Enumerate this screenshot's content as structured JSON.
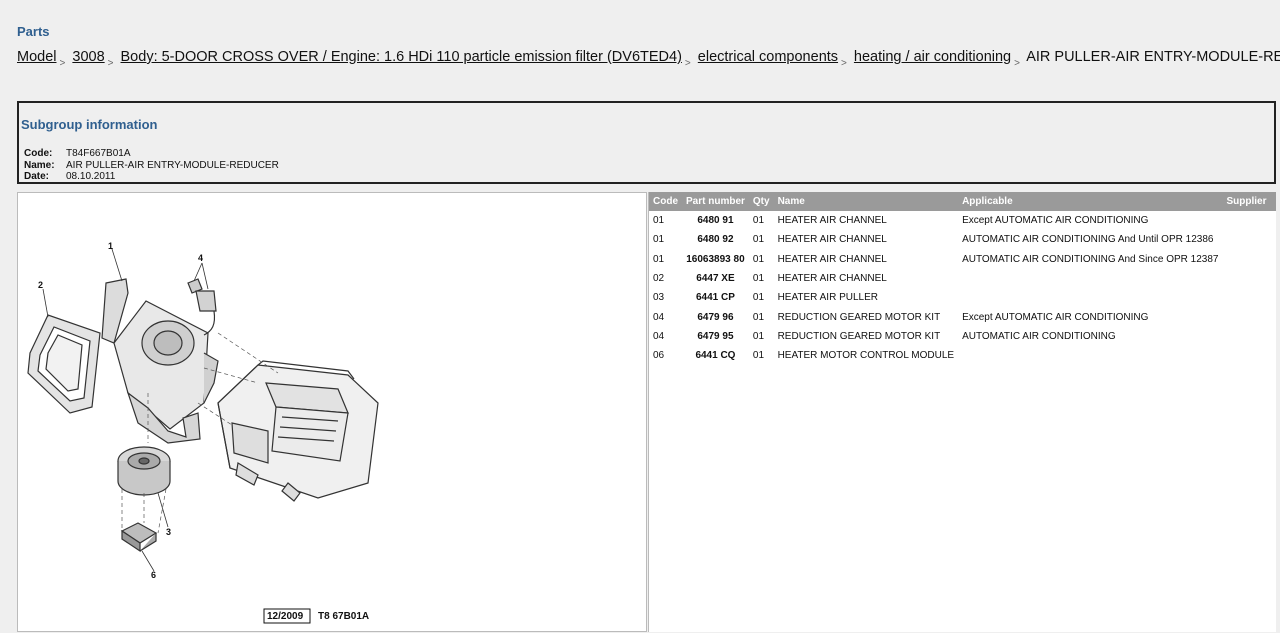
{
  "header": {
    "title": "Parts"
  },
  "breadcrumb": {
    "items": [
      "Model",
      "3008",
      "Body: 5-DOOR CROSS OVER / Engine: 1.6 HDi 110 particle emission filter (DV6TED4)",
      "electrical components",
      "heating / air conditioning"
    ],
    "current": "AIR PULLER-AIR ENTRY-MODULE-REDUCER",
    "separator": ">"
  },
  "subgroup": {
    "title": "Subgroup information",
    "code_label": "Code:",
    "code": "T84F667B01A",
    "name_label": "Name:",
    "name": "AIR PULLER-AIR ENTRY-MODULE-REDUCER",
    "date_label": "Date:",
    "date": "08.10.2011"
  },
  "diagram": {
    "callouts": [
      "1",
      "2",
      "3",
      "4",
      "6"
    ],
    "stamp_date": "12/2009",
    "stamp_ref": "T8 67B01A"
  },
  "table": {
    "headers": [
      "Code",
      "Part number",
      "Qty",
      "Name",
      "Applicable",
      "Supplier"
    ],
    "rows": [
      [
        "01",
        "6480 91",
        "01",
        "HEATER AIR CHANNEL",
        "Except AUTOMATIC AIR CONDITIONING",
        ""
      ],
      [
        "01",
        "6480 92",
        "01",
        "HEATER AIR CHANNEL",
        "AUTOMATIC AIR CONDITIONING And Until OPR 12386",
        ""
      ],
      [
        "01",
        "16063893 80",
        "01",
        "HEATER AIR CHANNEL",
        "AUTOMATIC AIR CONDITIONING And Since OPR 12387",
        ""
      ],
      [
        "02",
        "6447 XE",
        "01",
        "HEATER AIR CHANNEL",
        "",
        ""
      ],
      [
        "03",
        "6441 CP",
        "01",
        "HEATER AIR PULLER",
        "",
        ""
      ],
      [
        "04",
        "6479 96",
        "01",
        "REDUCTION GEARED MOTOR KIT",
        "Except AUTOMATIC AIR CONDITIONING",
        ""
      ],
      [
        "04",
        "6479 95",
        "01",
        "REDUCTION GEARED MOTOR KIT",
        "AUTOMATIC AIR CONDITIONING",
        ""
      ],
      [
        "06",
        "6441 CQ",
        "01",
        "HEATER MOTOR CONTROL MODULE",
        "",
        ""
      ]
    ]
  },
  "colors": {
    "title_blue": "#2f5f8f",
    "table_header_bg": "#9a9a9a",
    "page_bg": "#efefef"
  }
}
